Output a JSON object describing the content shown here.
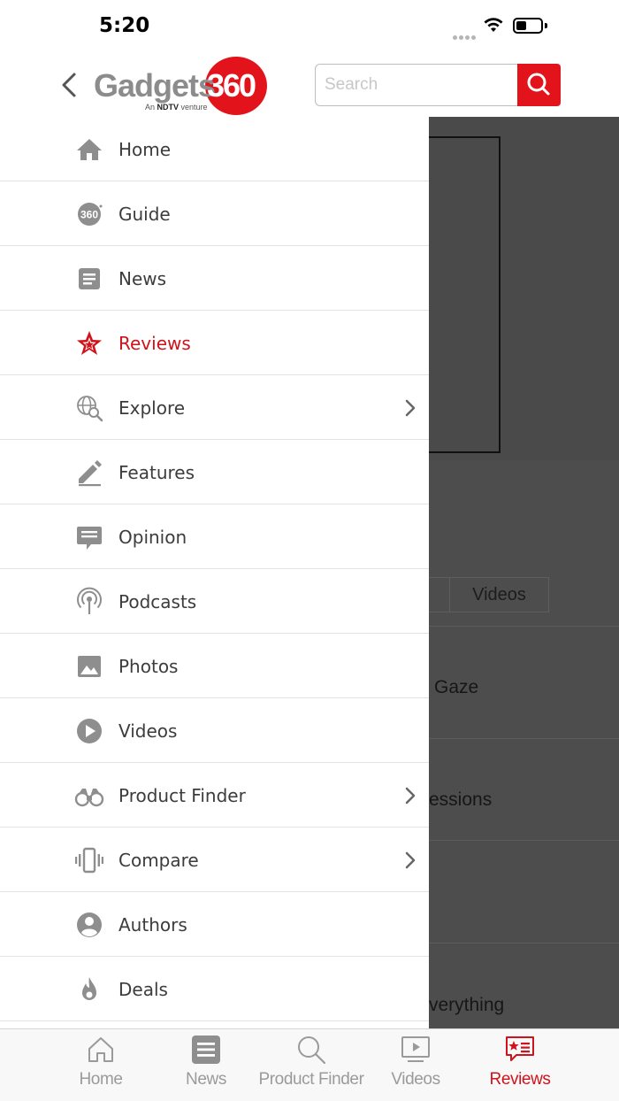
{
  "status": {
    "time": "5:20"
  },
  "header": {
    "logo_text": "Gadgets",
    "logo_number": "360",
    "logo_tagline_prefix": "An",
    "logo_tagline_brand": "NDTV",
    "logo_tagline_suffix": "venture",
    "search_placeholder": "Search"
  },
  "drawer": {
    "items": [
      {
        "label": "Home",
        "icon": "home-icon",
        "has_submenu": false,
        "active": false
      },
      {
        "label": "Guide",
        "icon": "guide-360-icon",
        "has_submenu": false,
        "active": false
      },
      {
        "label": "News",
        "icon": "news-icon",
        "has_submenu": false,
        "active": false
      },
      {
        "label": "Reviews",
        "icon": "star-icon",
        "has_submenu": false,
        "active": true
      },
      {
        "label": "Explore",
        "icon": "explore-globe-icon",
        "has_submenu": true,
        "active": false
      },
      {
        "label": "Features",
        "icon": "pencil-icon",
        "has_submenu": false,
        "active": false
      },
      {
        "label": "Opinion",
        "icon": "chat-bubble-icon",
        "has_submenu": false,
        "active": false
      },
      {
        "label": "Podcasts",
        "icon": "podcast-icon",
        "has_submenu": false,
        "active": false
      },
      {
        "label": "Photos",
        "icon": "image-icon",
        "has_submenu": false,
        "active": false
      },
      {
        "label": "Videos",
        "icon": "play-circle-icon",
        "has_submenu": false,
        "active": false
      },
      {
        "label": "Product Finder",
        "icon": "binoculars-icon",
        "has_submenu": true,
        "active": false
      },
      {
        "label": "Compare",
        "icon": "compare-icon",
        "has_submenu": true,
        "active": false
      },
      {
        "label": "Authors",
        "icon": "user-circle-icon",
        "has_submenu": false,
        "active": false
      },
      {
        "label": "Deals",
        "icon": "flame-icon",
        "has_submenu": false,
        "active": false
      }
    ]
  },
  "background": {
    "tab_partial": "n",
    "tab_videos": "Videos",
    "text_1": "Gaze",
    "text_2": "essions",
    "text_3": "verything"
  },
  "tabbar": {
    "tabs": [
      {
        "label": "Home",
        "icon": "home-outline-icon",
        "active": false
      },
      {
        "label": "News",
        "icon": "news-icon",
        "active": false
      },
      {
        "label": "Product Finder",
        "icon": "search-icon",
        "active": false
      },
      {
        "label": "Videos",
        "icon": "video-icon",
        "active": false
      },
      {
        "label": "Reviews",
        "icon": "reviews-icon",
        "active": true
      }
    ]
  },
  "colors": {
    "brand_red": "#e3131b",
    "active_red": "#d0121a",
    "icon_gray": "#8e8e8e",
    "overlay": "#4d4d4d"
  }
}
